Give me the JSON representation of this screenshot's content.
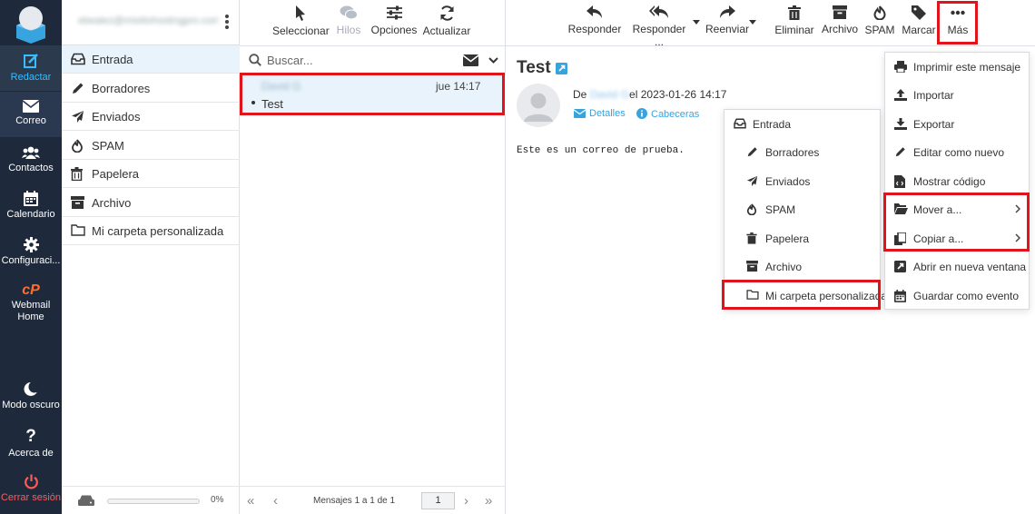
{
  "nav": {
    "compose": "Redactar",
    "mail": "Correo",
    "contacts": "Contactos",
    "calendar": "Calendario",
    "settings": "Configuraci...",
    "webmail_home_1": "Webmail",
    "webmail_home_2": "Home",
    "dark_mode": "Modo oscuro",
    "about": "Acerca de",
    "logout": "Cerrar sesión"
  },
  "account": {
    "email": "ebeatez@misitiohostingpro.com"
  },
  "folders": [
    {
      "label": "Entrada",
      "icon": "inbox-icon"
    },
    {
      "label": "Borradores",
      "icon": "pencil-icon"
    },
    {
      "label": "Enviados",
      "icon": "paper-plane-icon"
    },
    {
      "label": "SPAM",
      "icon": "fire-icon"
    },
    {
      "label": "Papelera",
      "icon": "trash-icon"
    },
    {
      "label": "Archivo",
      "icon": "archive-icon"
    },
    {
      "label": "Mi carpeta personalizada",
      "icon": "folder-icon"
    }
  ],
  "quota": {
    "percent": "0%",
    "fill_fraction": 0
  },
  "list_toolbar": {
    "select": "Seleccionar",
    "threads": "Hilos",
    "options": "Opciones",
    "refresh": "Actualizar"
  },
  "search": {
    "placeholder": "Buscar..."
  },
  "message": {
    "sender": "David G",
    "date": "jue 14:17",
    "subject": "Test"
  },
  "list_footer": {
    "count": "Mensajes 1 a 1 de 1",
    "page": "1"
  },
  "toolbar": {
    "reply": "Responder",
    "reply_all": "Responder ...",
    "forward": "Reenviar",
    "delete": "Eliminar",
    "archive": "Archivo",
    "spam": "SPAM",
    "mark": "Marcar",
    "more": "Más"
  },
  "reading": {
    "subject": "Test",
    "from_prefix": "De",
    "from_name": "David G",
    "from_date": "el 2023-01-26 14:17",
    "details": "Detalles",
    "headers": "Cabeceras",
    "body": "Este es un correo de prueba."
  },
  "more_menu": {
    "items": [
      "Imprimir este mensaje",
      "Importar",
      "Exportar",
      "Editar como nuevo",
      "Mostrar código",
      "Mover a...",
      "Copiar a...",
      "Abrir en nueva ventana",
      "Guardar como evento"
    ]
  },
  "move_menu": {
    "items": [
      "Entrada",
      "Borradores",
      "Enviados",
      "SPAM",
      "Papelera",
      "Archivo",
      "Mi carpeta personalizada"
    ]
  },
  "colors": {
    "accent": "#37beff",
    "highlight": "#e0151c",
    "nav_bg": "#1e2a3b",
    "logout": "#ff5a5a"
  }
}
